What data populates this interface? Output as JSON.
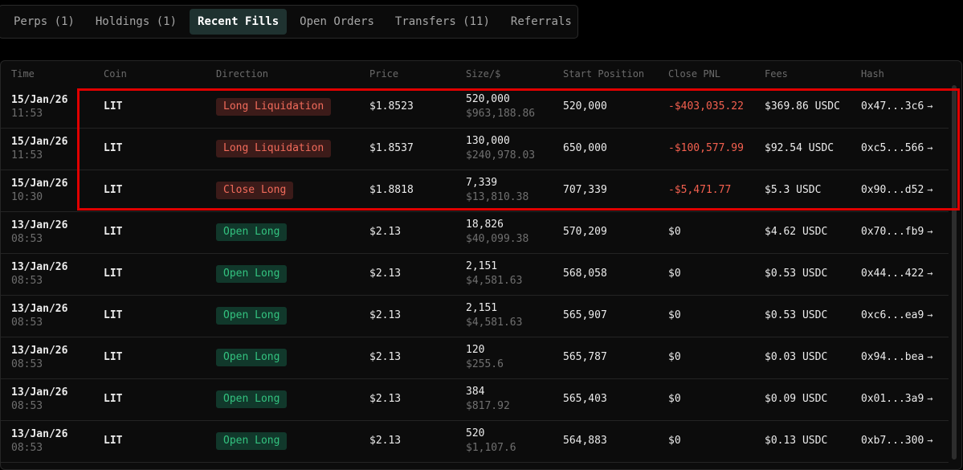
{
  "tabs": [
    {
      "label": "Perps (1)",
      "active": false
    },
    {
      "label": "Holdings (1)",
      "active": false
    },
    {
      "label": "Recent Fills",
      "active": true
    },
    {
      "label": "Open Orders",
      "active": false
    },
    {
      "label": "Transfers (11)",
      "active": false
    },
    {
      "label": "Referrals",
      "active": false
    }
  ],
  "table": {
    "headers": [
      "Time",
      "Coin",
      "Direction",
      "Price",
      "Size/$",
      "Start Position",
      "Close PNL",
      "Fees",
      "Hash"
    ],
    "rows": [
      {
        "date": "15/Jan/26",
        "time": "11:53",
        "coin": "LIT",
        "direction": "Long Liquidation",
        "price": "$1.8523",
        "size": "520,000",
        "size_usd": "$963,188.86",
        "start_position": "520,000",
        "close_pnl": "-$403,035.22",
        "fees": "$369.86 USDC",
        "hash": "0x47...3c6"
      },
      {
        "date": "15/Jan/26",
        "time": "11:53",
        "coin": "LIT",
        "direction": "Long Liquidation",
        "price": "$1.8537",
        "size": "130,000",
        "size_usd": "$240,978.03",
        "start_position": "650,000",
        "close_pnl": "-$100,577.99",
        "fees": "$92.54 USDC",
        "hash": "0xc5...566"
      },
      {
        "date": "15/Jan/26",
        "time": "10:30",
        "coin": "LIT",
        "direction": "Close Long",
        "price": "$1.8818",
        "size": "7,339",
        "size_usd": "$13,810.38",
        "start_position": "707,339",
        "close_pnl": "-$5,471.77",
        "fees": "$5.3 USDC",
        "hash": "0x90...d52"
      },
      {
        "date": "13/Jan/26",
        "time": "08:53",
        "coin": "LIT",
        "direction": "Open Long",
        "price": "$2.13",
        "size": "18,826",
        "size_usd": "$40,099.38",
        "start_position": "570,209",
        "close_pnl": "$0",
        "fees": "$4.62 USDC",
        "hash": "0x70...fb9"
      },
      {
        "date": "13/Jan/26",
        "time": "08:53",
        "coin": "LIT",
        "direction": "Open Long",
        "price": "$2.13",
        "size": "2,151",
        "size_usd": "$4,581.63",
        "start_position": "568,058",
        "close_pnl": "$0",
        "fees": "$0.53 USDC",
        "hash": "0x44...422"
      },
      {
        "date": "13/Jan/26",
        "time": "08:53",
        "coin": "LIT",
        "direction": "Open Long",
        "price": "$2.13",
        "size": "2,151",
        "size_usd": "$4,581.63",
        "start_position": "565,907",
        "close_pnl": "$0",
        "fees": "$0.53 USDC",
        "hash": "0xc6...ea9"
      },
      {
        "date": "13/Jan/26",
        "time": "08:53",
        "coin": "LIT",
        "direction": "Open Long",
        "price": "$2.13",
        "size": "120",
        "size_usd": "$255.6",
        "start_position": "565,787",
        "close_pnl": "$0",
        "fees": "$0.03 USDC",
        "hash": "0x94...bea"
      },
      {
        "date": "13/Jan/26",
        "time": "08:53",
        "coin": "LIT",
        "direction": "Open Long",
        "price": "$2.13",
        "size": "384",
        "size_usd": "$817.92",
        "start_position": "565,403",
        "close_pnl": "$0",
        "fees": "$0.09 USDC",
        "hash": "0x01...3a9"
      },
      {
        "date": "13/Jan/26",
        "time": "08:53",
        "coin": "LIT",
        "direction": "Open Long",
        "price": "$2.13",
        "size": "520",
        "size_usd": "$1,107.6",
        "start_position": "564,883",
        "close_pnl": "$0",
        "fees": "$0.13 USDC",
        "hash": "0xb7...300"
      }
    ]
  },
  "icons": {
    "hash_link": "arrow-right-icon"
  },
  "colors": {
    "tab_active_bg": "#1f3230",
    "liquidation_badge_bg": "#3c1b19",
    "liquidation_badge_text": "#f26b5b",
    "open_badge_bg": "#11382b",
    "open_badge_text": "#33c27f",
    "negative_pnl": "#f4604f",
    "highlight_box": "#e00000"
  }
}
